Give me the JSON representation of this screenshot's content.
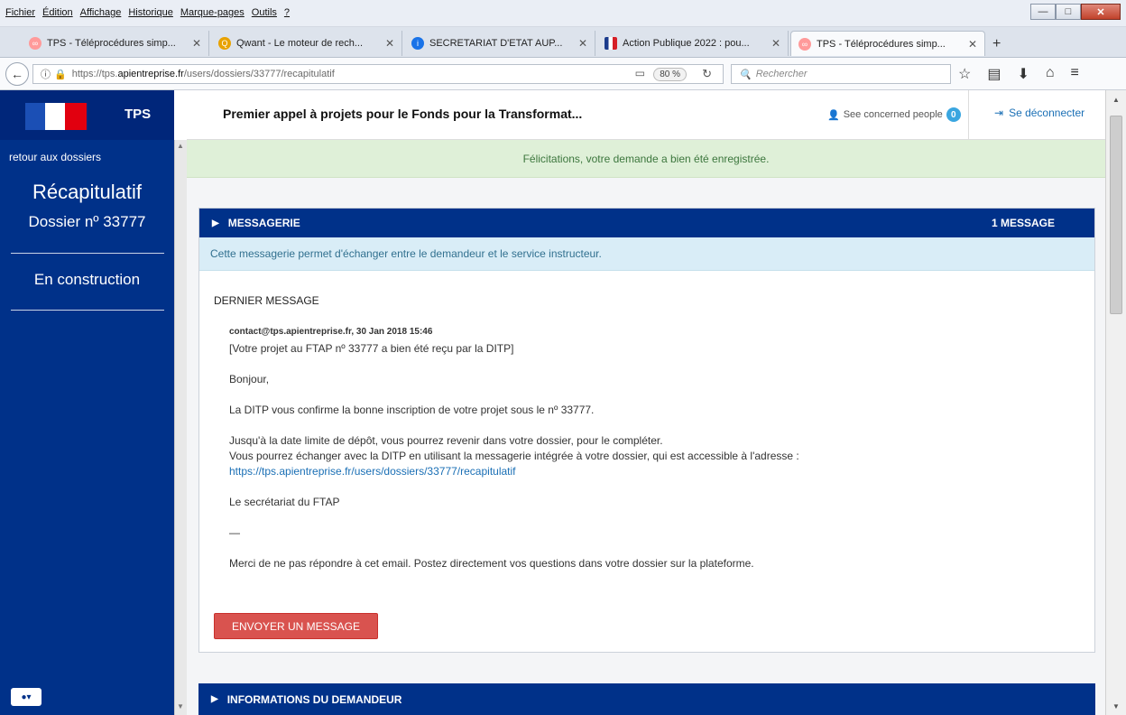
{
  "browser": {
    "menu": [
      "Fichier",
      "Édition",
      "Affichage",
      "Historique",
      "Marque-pages",
      "Outils",
      "?"
    ],
    "tabs": [
      {
        "label": "TPS - Téléprocédures simp...",
        "color": "#ff7b7b"
      },
      {
        "label": "Qwant - Le moteur de rech...",
        "color": "#e8a200"
      },
      {
        "label": "SECRETARIAT D'ETAT AUP...",
        "color": "#1a73e8"
      },
      {
        "label": "Action Publique 2022 : pou...",
        "color": "#2b3f8f"
      },
      {
        "label": "TPS - Téléprocédures simp...",
        "color": "#ff7b7b"
      }
    ],
    "url_prefix": "https://tps.",
    "url_domain": "apientreprise.fr",
    "url_path": "/users/dossiers/33777/recapitulatif",
    "zoom": "80 %",
    "search_placeholder": "Rechercher"
  },
  "sidebar": {
    "brand": "TPS",
    "back_link": "retour aux dossiers",
    "page_title": "Récapitulatif",
    "dossier": "Dossier nº 33777",
    "status": "En construction"
  },
  "header": {
    "title": "Premier appel à projets pour le Fonds pour la Transformat...",
    "people_label": "See concerned people",
    "people_count": "0",
    "logout": "Se déconnecter"
  },
  "main": {
    "success": "Félicitations, votre demande a bien été enregistrée.",
    "messaging": {
      "title": "MESSAGERIE",
      "count": "1 MESSAGE",
      "info": "Cette messagerie permet d'échanger entre le demandeur et le service instructeur.",
      "last_label": "DERNIER MESSAGE",
      "from": "contact@tps.apientreprise.fr, 30 Jan 2018 15:46",
      "subject": "[Votre projet au FTAP nº 33777 a bien été reçu par la DITP]",
      "greeting": "Bonjour,",
      "line1": "La DITP vous confirme la bonne inscription de votre projet  sous le nº 33777.",
      "line2": "Jusqu'à la date limite de dépôt, vous pourrez revenir dans votre dossier, pour le compléter.",
      "line3": "Vous pourrez échanger avec la DITP en utilisant la messagerie intégrée à votre dossier, qui est accessible à l'adresse : ",
      "link": "https://tps.apientreprise.fr/users/dossiers/33777/recapitulatif",
      "signature": "Le secrétariat du FTAP",
      "dash": "—",
      "footer": "Merci de ne pas répondre à cet email. Postez directement vos questions dans votre dossier sur la plateforme.",
      "send_button": "ENVOYER UN MESSAGE"
    },
    "applicant_title": "INFORMATIONS DU DEMANDEUR"
  }
}
